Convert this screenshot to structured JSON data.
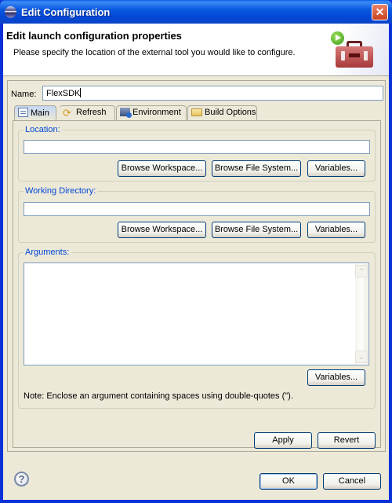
{
  "window": {
    "title": "Edit Configuration",
    "close_label": "✕"
  },
  "header": {
    "title": "Edit launch configuration properties",
    "description": "Please specify the location of the external tool you would like to configure."
  },
  "name_field": {
    "label": "Name:",
    "value": "FlexSDK"
  },
  "tabs": [
    {
      "label": "Main",
      "icon": "main-tab-icon",
      "active": true
    },
    {
      "label": "Refresh",
      "icon": "refresh-icon",
      "active": false
    },
    {
      "label": "Environment",
      "icon": "environment-icon",
      "active": false
    },
    {
      "label": "Build Options",
      "icon": "folder-open-icon",
      "active": false
    }
  ],
  "location": {
    "label": "Location:",
    "value": "",
    "browse_workspace": "Browse Workspace...",
    "browse_file_system": "Browse File System...",
    "variables": "Variables..."
  },
  "working_directory": {
    "label": "Working Directory:",
    "value": "",
    "browse_workspace": "Browse Workspace...",
    "browse_file_system": "Browse File System...",
    "variables": "Variables..."
  },
  "arguments": {
    "label": "Arguments:",
    "value": "",
    "variables": "Variables...",
    "scroll_up": "⌃",
    "scroll_down": "⌄",
    "note": "Note: Enclose an argument containing spaces using double-quotes (\")."
  },
  "actions": {
    "apply": "Apply",
    "revert": "Revert",
    "ok": "OK",
    "cancel": "Cancel",
    "help": "?"
  }
}
